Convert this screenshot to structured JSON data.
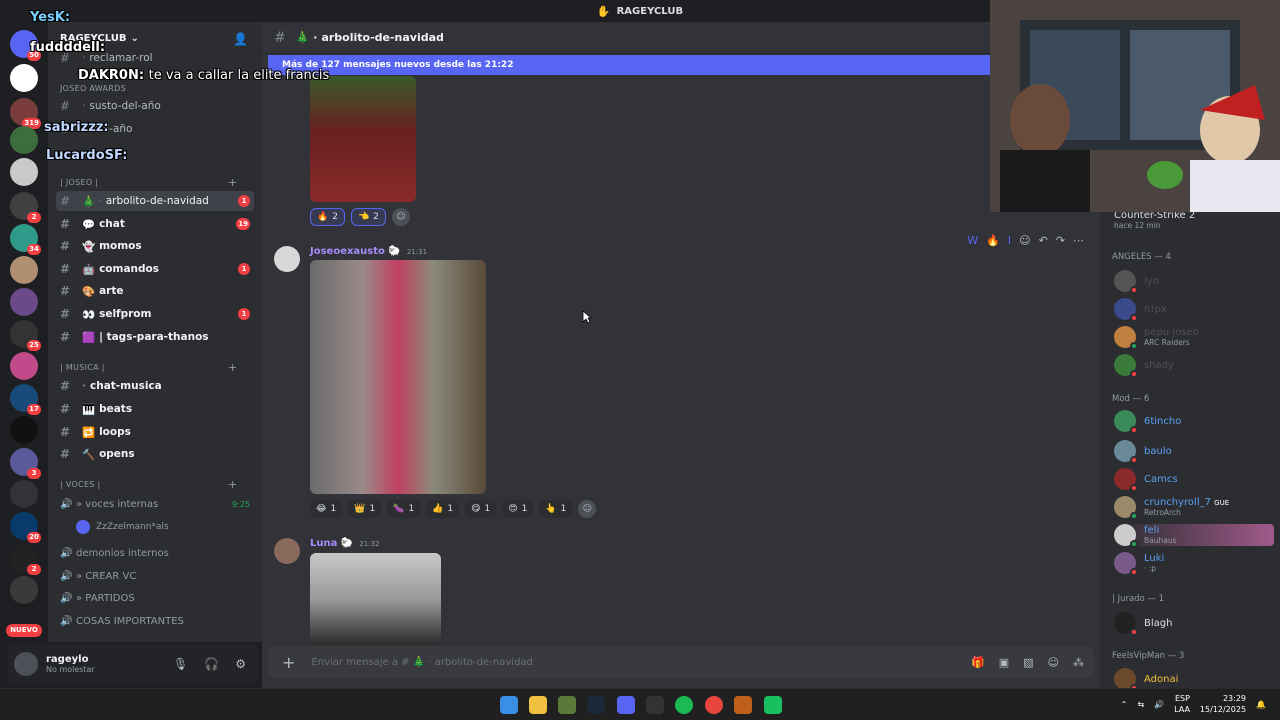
{
  "app": {
    "title": "RAGEYCLUB"
  },
  "server": {
    "name": "RAGEYCLUB"
  },
  "channels": {
    "top": [
      {
        "name": "reclamar-rol"
      }
    ],
    "awards_category": "JOSEO AWARDS",
    "awards": [
      {
        "name": "susto-del-año"
      },
      {
        "name": "-del-año"
      }
    ],
    "joseo_category": "| JOSEO |",
    "joseo": [
      {
        "name": "arbolito-de-navidad",
        "badge": "1"
      },
      {
        "name": "chat",
        "badge": "19"
      },
      {
        "name": "momos",
        "badge": ""
      },
      {
        "name": "comandos",
        "badge": "1"
      },
      {
        "name": "arte",
        "badge": ""
      },
      {
        "name": "selfprom",
        "badge": "1"
      },
      {
        "name": "| tags-para-thanos",
        "badge": ""
      }
    ],
    "musica_category": "| MUSICA |",
    "musica": [
      {
        "name": "chat-musica"
      },
      {
        "name": "beats"
      },
      {
        "name": "loops"
      },
      {
        "name": "opens"
      }
    ],
    "voces_category": "| VOCES |",
    "voices": [
      {
        "name": "» voces internas",
        "time": "9:25"
      },
      {
        "name": "demonios internos",
        "time": ""
      },
      {
        "name": "» CREAR VC",
        "time": ""
      },
      {
        "name": "» PARTIDOS",
        "time": ""
      },
      {
        "name": "COSAS IMPORTANTES",
        "time": ""
      }
    ],
    "voice_user": "ZzZzelmann*als"
  },
  "user": {
    "name": "rageylo",
    "status": "No molestar"
  },
  "chat": {
    "channel_title": "arbolito-de-navidad",
    "new_messages": "Más de 127 mensajes nuevos desde las 21:22",
    "reactions_top": [
      {
        "emoji": "🔥",
        "count": "2"
      },
      {
        "emoji": "👈",
        "count": "2"
      }
    ],
    "message1": {
      "author": "Joseoexausto",
      "time": "21:31"
    },
    "reactions_mid": [
      {
        "emoji": "😂",
        "count": "1"
      },
      {
        "emoji": "👑",
        "count": "1"
      },
      {
        "emoji": "🍆",
        "count": "1"
      },
      {
        "emoji": "👍",
        "count": "1"
      },
      {
        "emoji": "😋",
        "count": "1"
      },
      {
        "emoji": "😍",
        "count": "1"
      },
      {
        "emoji": "👆",
        "count": "1"
      }
    ],
    "message2": {
      "author": "Luna",
      "time": "21:32"
    },
    "composer_placeholder": "Enviar mensaje a # 🎄 · arbolito-de-navidad"
  },
  "members": {
    "activity": {
      "game": "Counter-Strike 2",
      "time": "hace 12 min"
    },
    "angeles_group": "ANGELES — 4",
    "angeles": [
      {
        "name": "lyn",
        "sub": ""
      },
      {
        "name": "n!px",
        "sub": ""
      },
      {
        "name": "pepu joseo",
        "sub": "ARC Raiders"
      },
      {
        "name": "shady",
        "sub": ""
      }
    ],
    "mod_group": "Mod — 6",
    "mods": [
      {
        "name": "6tincho",
        "sub": ""
      },
      {
        "name": "baulo",
        "sub": ""
      },
      {
        "name": "Camcs",
        "sub": ""
      },
      {
        "name": "crunchyroll_7",
        "tag": "GUE",
        "sub": "RetroArch"
      },
      {
        "name": "feli",
        "sub": "Bauhaus"
      },
      {
        "name": "Luki",
        "sub": "· :p"
      }
    ],
    "jurado_group": "| Jurado — 1",
    "jurado": [
      {
        "name": "Blagh"
      }
    ],
    "vip_group": "FeelsVipMan — 3",
    "vip": [
      {
        "name": "Adonai"
      }
    ]
  },
  "stream_overlay": [
    {
      "user": "YesK:",
      "text": ""
    },
    {
      "user": "fuddddell:",
      "text": ""
    },
    {
      "user": "DAKR0N:",
      "text": "te va a callar la elite francis"
    },
    {
      "user": "sabrizzz:",
      "text": ""
    },
    {
      "user": "LucardoSF:",
      "text": ""
    }
  ],
  "rail_badges": {
    "b1": "50",
    "b2": "319",
    "b3": "2",
    "b4": "34",
    "b5": "25",
    "b6": "17",
    "b7": "3",
    "b8": "20",
    "b9": "2",
    "nuevo": "NUEVO"
  },
  "taskbar": {
    "lang1": "ESP",
    "lang2": "LAA",
    "time": "23:29",
    "date": "15/12/2025"
  },
  "colors": {
    "accent": "#5865f2",
    "danger": "#f23f43",
    "online": "#23a55a"
  }
}
